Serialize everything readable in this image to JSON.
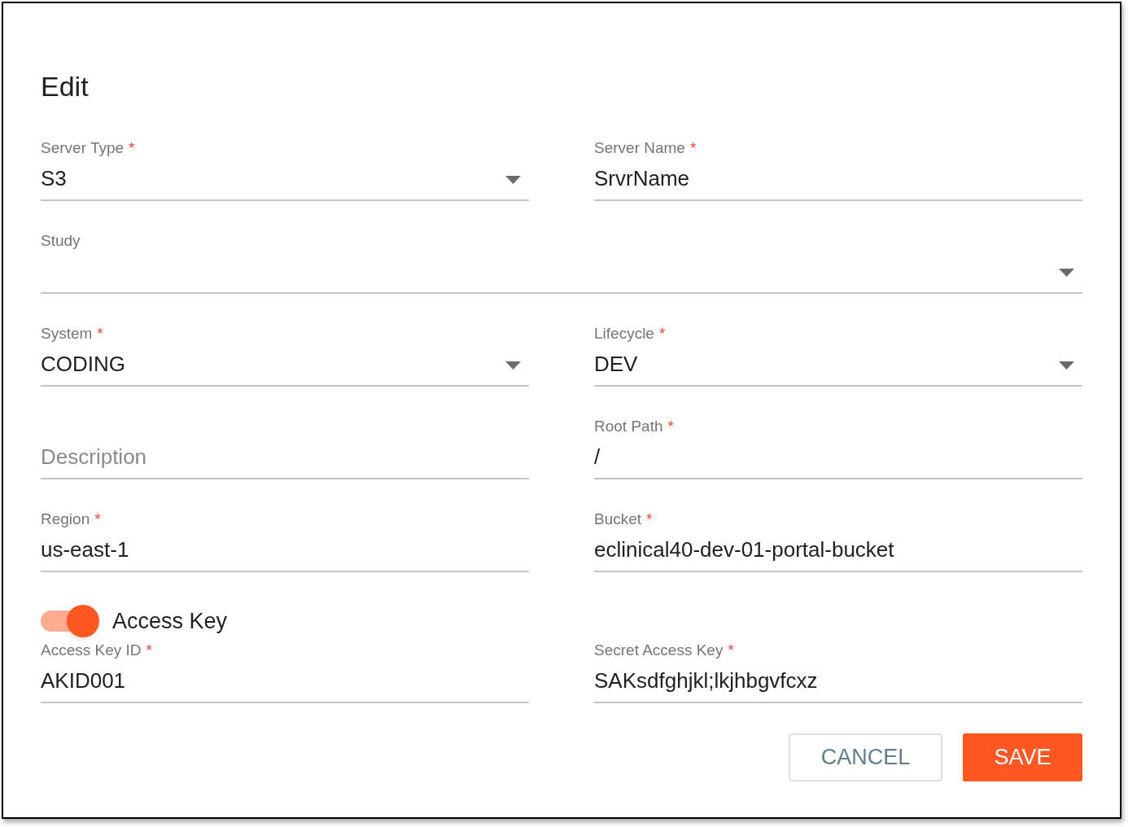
{
  "dialog": {
    "title": "Edit"
  },
  "sections": [
    {
      "kind": "fields",
      "fields": [
        {
          "kind": "select",
          "label": "Server Type",
          "required_mark": "*",
          "value": "S3"
        },
        {
          "kind": "text",
          "label": "Server Name",
          "required_mark": "*",
          "value": "SrvrName"
        }
      ]
    },
    {
      "kind": "fields",
      "fields": [
        {
          "kind": "select",
          "label": "Study"
        }
      ]
    },
    {
      "kind": "fields",
      "fields": [
        {
          "kind": "select",
          "label": "System",
          "required_mark": "*",
          "value": "CODING"
        },
        {
          "kind": "select",
          "label": "Lifecycle",
          "required_mark": "*",
          "value": "DEV"
        }
      ]
    },
    {
      "kind": "fields",
      "fields": [
        {
          "kind": "text",
          "placeholder": "Description"
        },
        {
          "kind": "text",
          "label": "Root Path",
          "required_mark": "*",
          "value": "/"
        }
      ]
    },
    {
      "kind": "fields",
      "fields": [
        {
          "kind": "text",
          "label": "Region",
          "required_mark": "*",
          "value": "us-east-1"
        },
        {
          "kind": "text",
          "label": "Bucket",
          "required_mark": "*",
          "value": "eclinical40-dev-01-portal-bucket"
        }
      ]
    },
    {
      "kind": "toggle",
      "label": "Access Key",
      "on": true
    },
    {
      "kind": "fields",
      "fields": [
        {
          "kind": "text",
          "label": "Access Key ID",
          "required_mark": "*",
          "value": "AKID001"
        },
        {
          "kind": "text",
          "label": "Secret Access Key",
          "required_mark": "*",
          "value": "SAKsdfghjkl;lkjhbgvfcxz"
        }
      ]
    }
  ],
  "buttons": [
    {
      "kind": "outlined",
      "label": "CANCEL"
    },
    {
      "kind": "primary",
      "label": "SAVE"
    }
  ]
}
